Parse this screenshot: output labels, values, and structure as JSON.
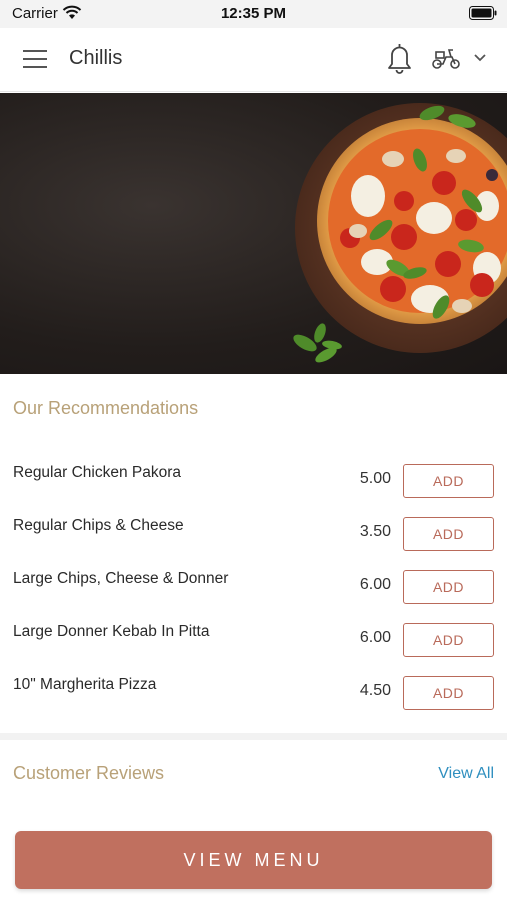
{
  "status_bar": {
    "carrier": "Carrier",
    "time": "12:35 PM"
  },
  "header": {
    "title": "Chillis",
    "icons": [
      "menu-icon",
      "bell-icon",
      "scooter-icon",
      "chevron-down-icon"
    ]
  },
  "hero": {
    "image": "pizza-image"
  },
  "recommendations": {
    "title": "Our Recommendations",
    "items": [
      {
        "name": "Regular Chicken Pakora",
        "price": "5.00",
        "button": "ADD"
      },
      {
        "name": "Regular Chips & Cheese",
        "price": "3.50",
        "button": "ADD"
      },
      {
        "name": "Large Chips, Cheese & Donner",
        "price": "6.00",
        "button": "ADD"
      },
      {
        "name": "Large Donner Kebab In Pitta",
        "price": "6.00",
        "button": "ADD"
      },
      {
        "name": "10\" Margherita Pizza",
        "price": "4.50",
        "button": "ADD"
      }
    ]
  },
  "reviews": {
    "title": "Customer Reviews",
    "view_all": "View All"
  },
  "footer": {
    "view_menu": "VIEW MENU"
  },
  "colors": {
    "accent": "#c0705f",
    "section_title": "#b8a178",
    "link": "#2f8fbf"
  }
}
